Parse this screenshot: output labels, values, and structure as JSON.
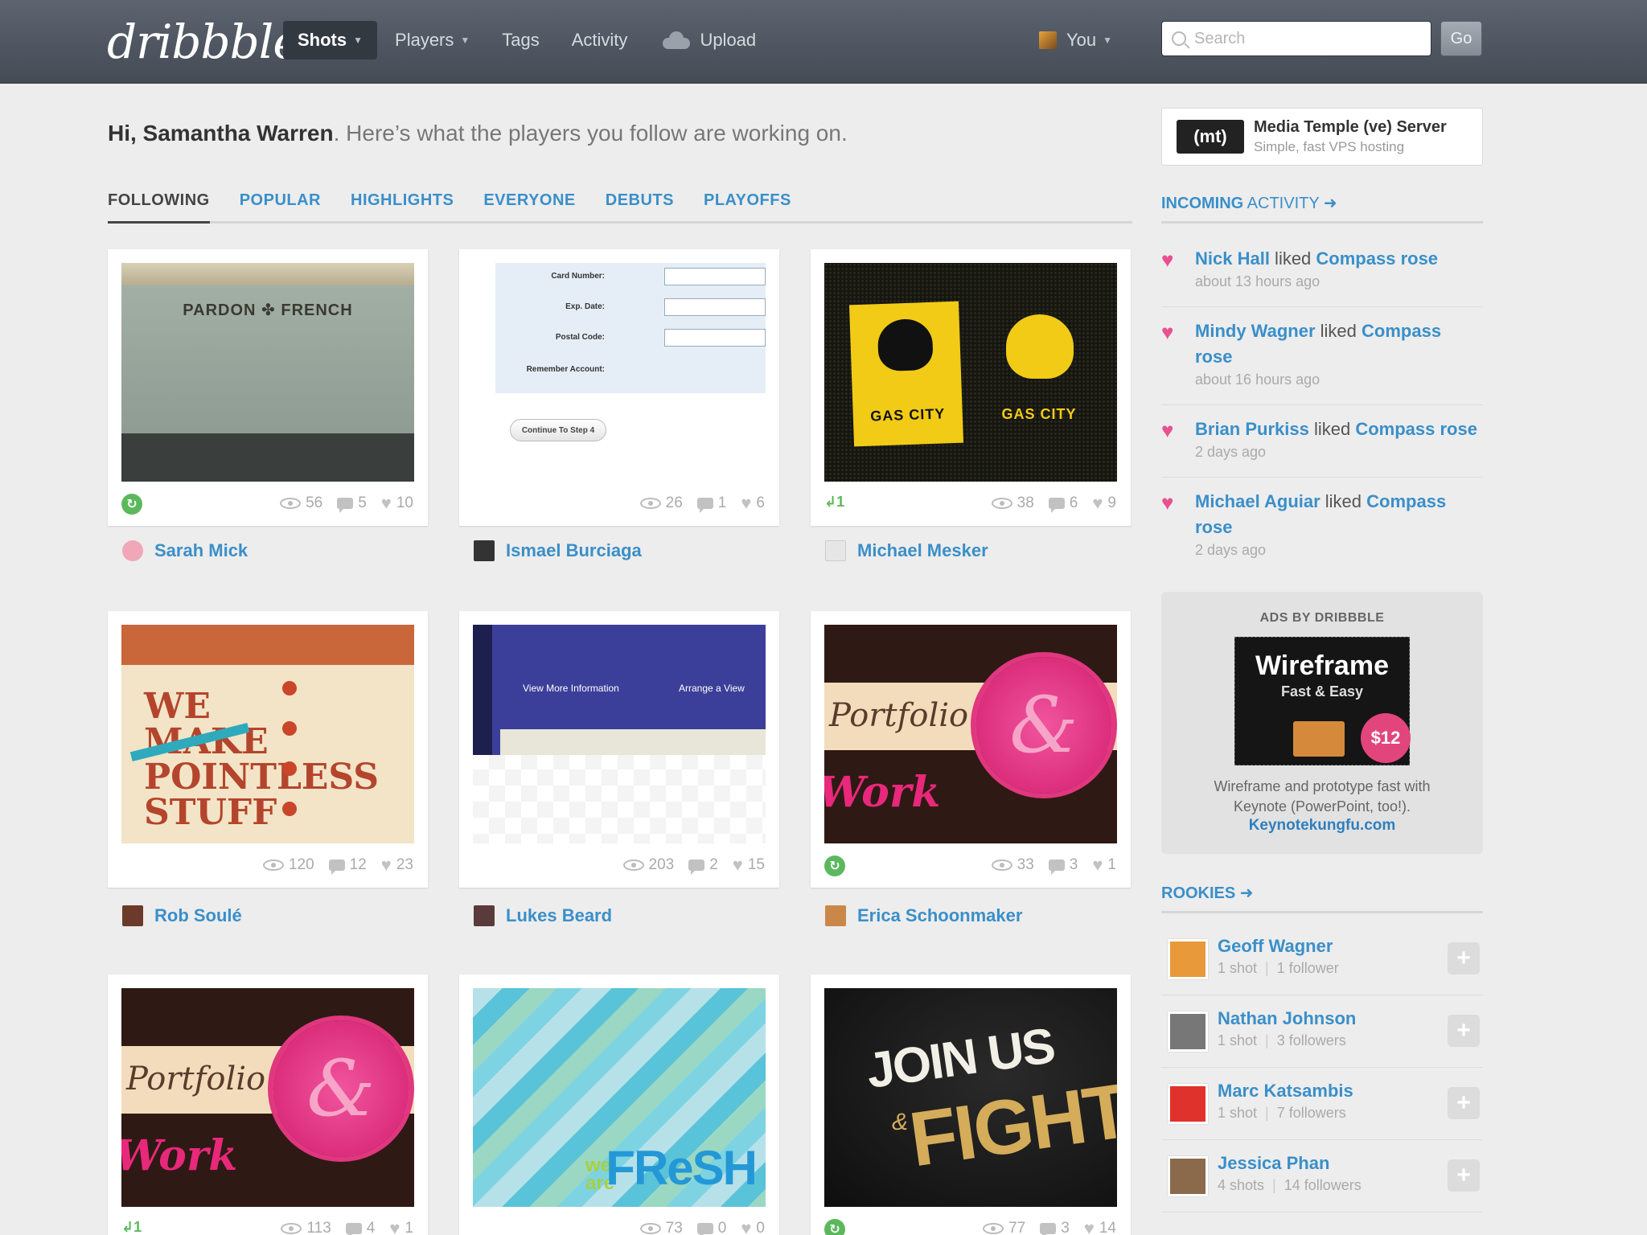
{
  "header": {
    "logo": "dribbble",
    "nav": [
      {
        "label": "Shots",
        "active": true,
        "dropdown": true
      },
      {
        "label": "Players",
        "active": false,
        "dropdown": true
      },
      {
        "label": "Tags",
        "active": false,
        "dropdown": false
      },
      {
        "label": "Activity",
        "active": false,
        "dropdown": false
      },
      {
        "label": "Upload",
        "active": false,
        "dropdown": false
      }
    ],
    "user_label": "You",
    "search_placeholder": "Search",
    "go_label": "Go"
  },
  "greeting": {
    "name": "Hi, Samantha Warren",
    "text": ". Here’s what the players you follow are working on."
  },
  "tabs": [
    "FOLLOWING",
    "POPULAR",
    "HIGHLIGHTS",
    "EVERYONE",
    "DEBUTS",
    "PLAYOFFS"
  ],
  "art_text": {
    "pardon": "PARDON ✤ FRENCH",
    "form_card": "Card Number:",
    "form_exp": "Exp. Date:",
    "form_postal": "Postal Code:",
    "form_remember": "Remember Account:",
    "form_btn": "Continue To Step 4",
    "gas_city": "GAS CITY",
    "pointless_big": "WE MAKE POINTLESS STUFF",
    "realty_view": "View More Information",
    "realty_arrange": "Arrange a View",
    "portfolio": "Portfolio",
    "work": "Work",
    "seal": "&",
    "fresh_we": "we are",
    "fresh": "FReSH",
    "join": "JOIN US",
    "amp": "&",
    "fight": "FIGHT"
  },
  "shots": [
    {
      "views": "56",
      "comments": "5",
      "likes": "10",
      "rebound": "",
      "player": "Sarah Mick",
      "avatar_color": "#f0a7b8"
    },
    {
      "views": "26",
      "comments": "1",
      "likes": "6",
      "rebound": "",
      "player": "Ismael Burciaga",
      "avatar_color": "#333333"
    },
    {
      "views": "38",
      "comments": "6",
      "likes": "9",
      "rebound": "↲1",
      "player": "Michael Mesker",
      "avatar_color": "#dddddd"
    },
    {
      "views": "120",
      "comments": "12",
      "likes": "23",
      "rebound": "",
      "player": "Rob Soulé",
      "avatar_color": "#6b3a2a"
    },
    {
      "views": "203",
      "comments": "2",
      "likes": "15",
      "rebound": "",
      "player": "Lukes Beard",
      "avatar_color": "#5a3a3a"
    },
    {
      "views": "33",
      "comments": "3",
      "likes": "1",
      "rebound": "",
      "player": "Erica Schoonmaker",
      "avatar_color": "#c9884a"
    },
    {
      "views": "113",
      "comments": "4",
      "likes": "1",
      "rebound": "↲1",
      "player": "",
      "avatar_color": ""
    },
    {
      "views": "73",
      "comments": "0",
      "likes": "0",
      "rebound": "",
      "player": "",
      "avatar_color": ""
    },
    {
      "views": "77",
      "comments": "3",
      "likes": "14",
      "rebound": "",
      "player": "",
      "avatar_color": ""
    }
  ],
  "sidebar": {
    "ad_top": {
      "logo": "(mt)",
      "title": "Media Temple (ve) Server",
      "subtitle": "Simple, fast VPS hosting"
    },
    "incoming_head": "INCOMING",
    "incoming_head_light": " ACTIVITY ➜",
    "activity": [
      {
        "user": "Nick Hall",
        "verb": " liked ",
        "shot": "Compass rose",
        "time": "about 13 hours ago"
      },
      {
        "user": "Mindy Wagner",
        "verb": " liked ",
        "shot": "Compass rose",
        "time": "about 16 hours ago"
      },
      {
        "user": "Brian Purkiss",
        "verb": " liked ",
        "shot": "Compass rose",
        "time": "2 days ago"
      },
      {
        "user": "Michael Aguiar",
        "verb": " liked ",
        "shot": "Compass rose",
        "time": "2 days ago"
      }
    ],
    "ad": {
      "label": "ADS BY DRIBBBLE",
      "title": "Wireframe",
      "subtitle": "Fast & Easy",
      "price": "$12",
      "copy_1": "Wireframe and prototype fast with",
      "copy_2": "Keynote (PowerPoint, too!).",
      "link": "Keynotekungfu.com"
    },
    "rookies_head": "ROOKIES ➜",
    "rookies": [
      {
        "name": "Geoff Wagner",
        "shots": "1 shot",
        "followers": "1 follower",
        "color": "#e89a3a"
      },
      {
        "name": "Nathan Johnson",
        "shots": "1 shot",
        "followers": "3 followers",
        "color": "#777777"
      },
      {
        "name": "Marc Katsambis",
        "shots": "1 shot",
        "followers": "7 followers",
        "color": "#e0322c"
      },
      {
        "name": "Jessica Phan",
        "shots": "4 shots",
        "followers": "14 followers",
        "color": "#8a6a4a"
      }
    ],
    "follow_label": "+"
  }
}
